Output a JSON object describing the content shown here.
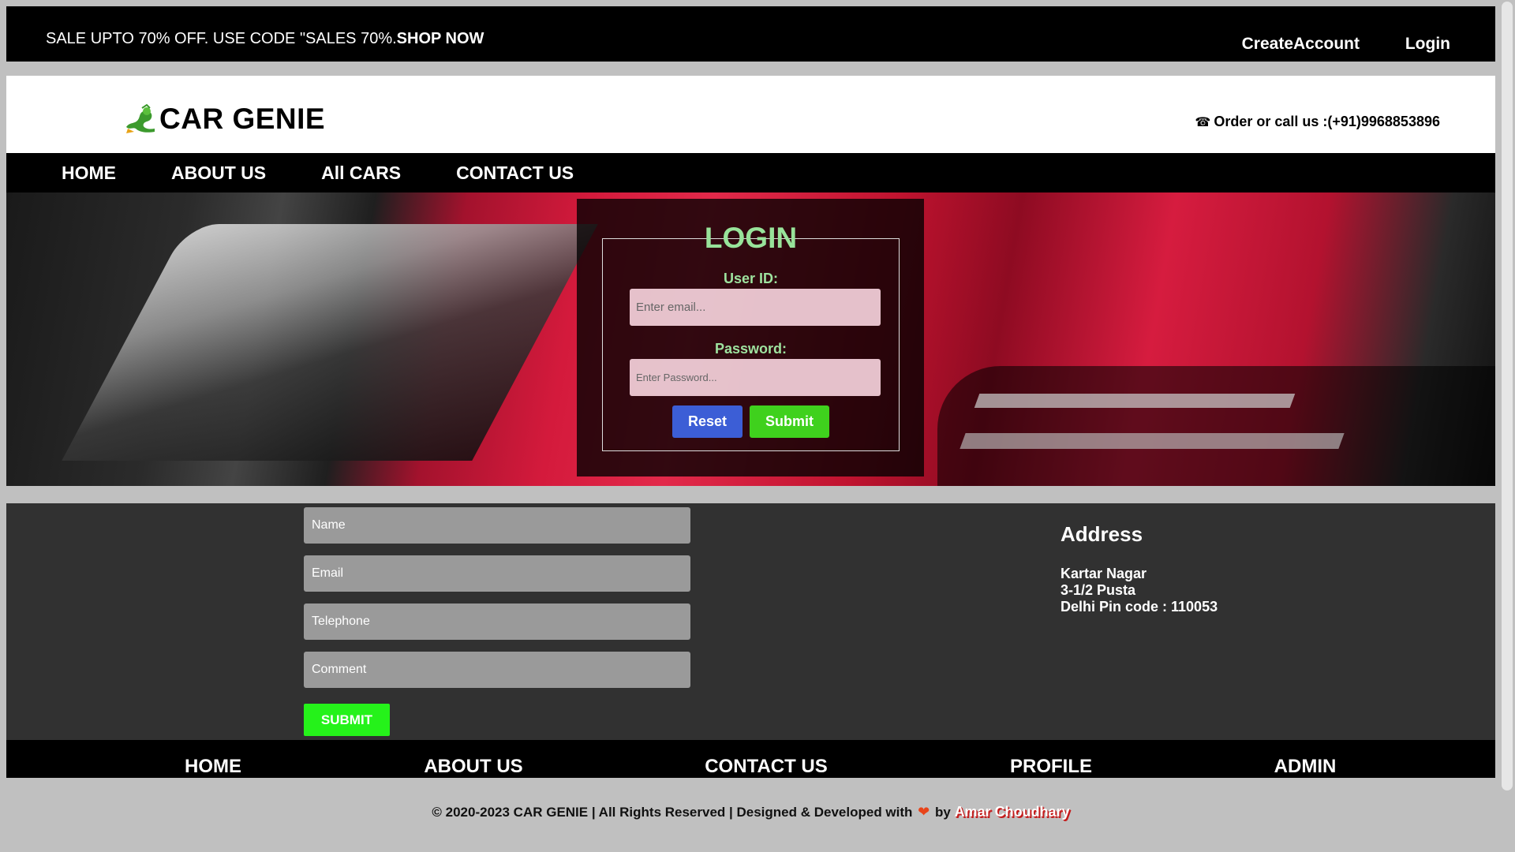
{
  "topbar": {
    "promo_text": "SALE UPTO 70% OFF. USE CODE \"SALES 70%.",
    "promo_link": "SHOP NOW",
    "create_account": "CreateAccount",
    "login": "Login"
  },
  "header": {
    "brand": "CAR GENIE",
    "phone_icon": "☎",
    "call_text": "Order or call us :(+91)9968853896"
  },
  "nav": {
    "items": [
      "HOME",
      "ABOUT US",
      "All CARS",
      "CONTACT US"
    ]
  },
  "login": {
    "title": "LOGIN",
    "user_label": "User ID:",
    "user_placeholder": "Enter email...",
    "password_label": "Password:",
    "password_placeholder": "Enter Password...",
    "reset": "Reset",
    "submit": "Submit"
  },
  "contact": {
    "name_placeholder": "Name",
    "email_placeholder": "Email",
    "telephone_placeholder": "Telephone",
    "comment_placeholder": "Comment",
    "submit": "SUBMIT"
  },
  "address": {
    "title": "Address",
    "line1": "Kartar Nagar",
    "line2": "3-1/2 Pusta",
    "line3": "Delhi Pin code : 110053"
  },
  "footer_nav": {
    "items": [
      "HOME",
      "ABOUT US",
      "CONTACT US",
      "PROFILE",
      "ADMIN"
    ]
  },
  "copyright": {
    "text": "© 2020-2023 CAR GENIE | All Rights Reserved | Designed & Developed with",
    "heart": "❤",
    "by": "by",
    "author": "Amar Choudhary"
  },
  "colors": {
    "login_title": "#98e39a",
    "reset_button": "#3c5ed6",
    "submit_button": "#3fd11d",
    "contact_submit": "#25f21a"
  }
}
